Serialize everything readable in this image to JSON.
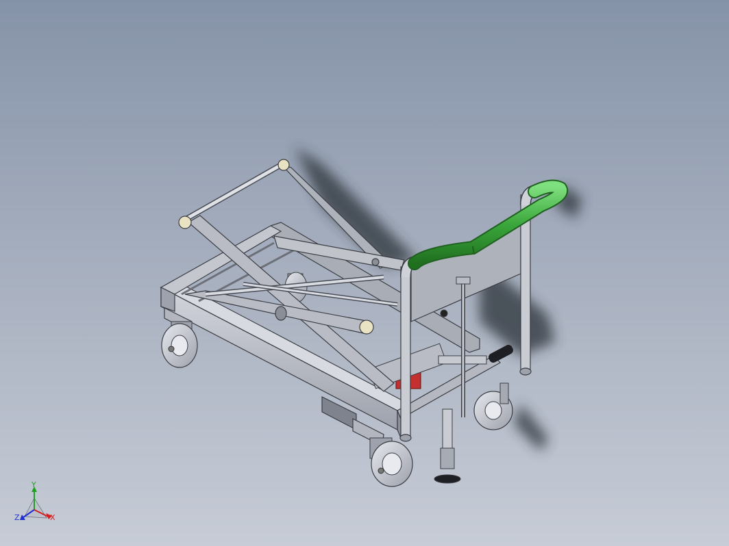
{
  "viewport": {
    "background_top": "#8593a8",
    "background_bottom": "#c7ccd6"
  },
  "model": {
    "frame_color": "#b9bcc4",
    "frame_edge_color": "#3a3c42",
    "handle_color": "#3aa63a",
    "cylinder_color": "#c42f2f",
    "wheel_color": "#c9cbd2"
  },
  "triad": {
    "x_label": "X",
    "y_label": "Y",
    "z_label": "Z",
    "x_color": "#d42020",
    "y_color": "#20a020",
    "z_color": "#2030d0"
  }
}
